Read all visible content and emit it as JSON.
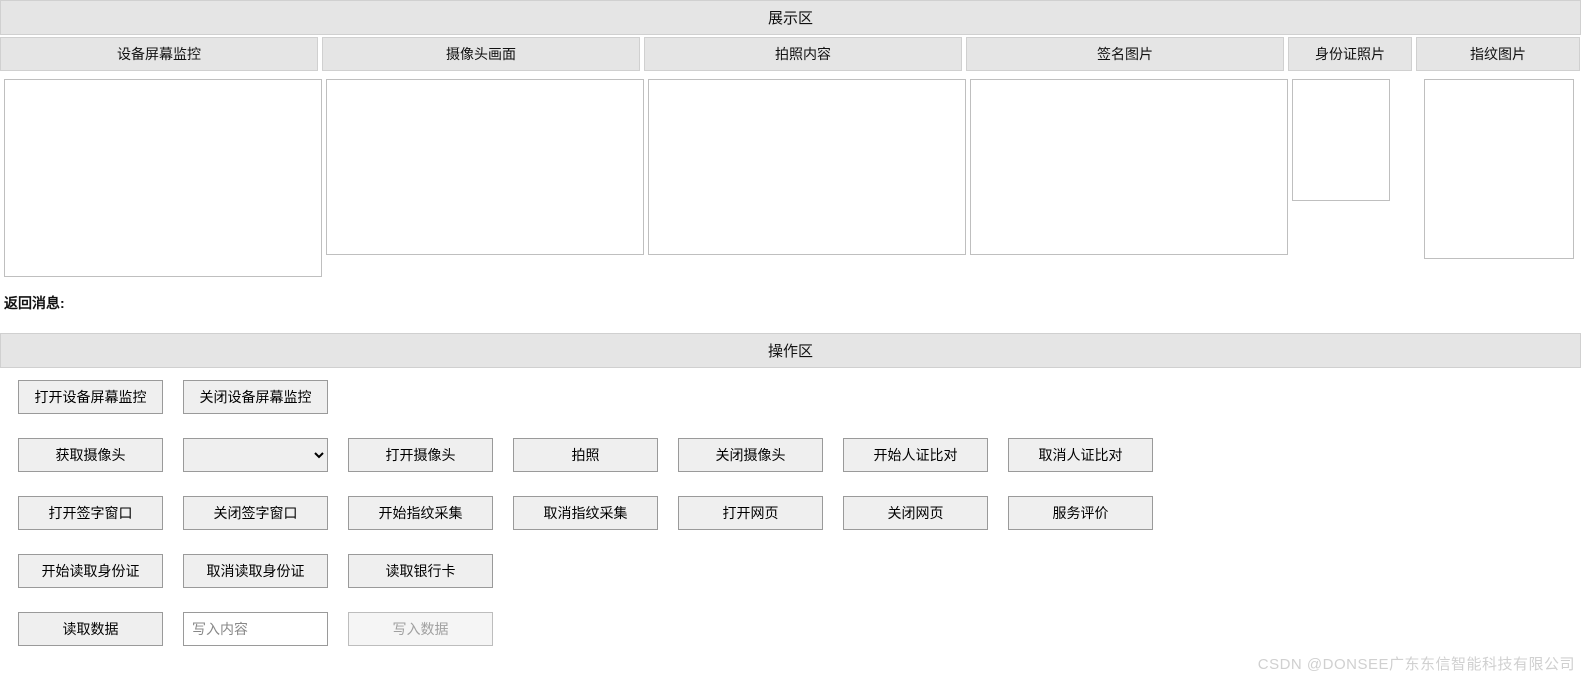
{
  "display_section": {
    "title": "展示区",
    "columns": [
      "设备屏幕监控",
      "摄像头画面",
      "拍照内容",
      "签名图片",
      "身份证照片",
      "指纹图片"
    ]
  },
  "return_message": {
    "label": "返回消息:",
    "value": ""
  },
  "operation_section": {
    "title": "操作区"
  },
  "buttons": {
    "row1": {
      "open_monitor": "打开设备屏幕监控",
      "close_monitor": "关闭设备屏幕监控"
    },
    "row2": {
      "get_camera": "获取摄像头",
      "camera_select": "",
      "open_camera": "打开摄像头",
      "take_photo": "拍照",
      "close_camera": "关闭摄像头",
      "start_face_compare": "开始人证比对",
      "cancel_face_compare": "取消人证比对"
    },
    "row3": {
      "open_sign_window": "打开签字窗口",
      "close_sign_window": "关闭签字窗口",
      "start_fingerprint": "开始指纹采集",
      "cancel_fingerprint": "取消指纹采集",
      "open_webpage": "打开网页",
      "close_webpage": "关闭网页",
      "service_review": "服务评价"
    },
    "row4": {
      "start_read_id": "开始读取身份证",
      "cancel_read_id": "取消读取身份证",
      "read_bank_card": "读取银行卡"
    },
    "row5": {
      "read_data": "读取数据",
      "write_placeholder": "写入内容",
      "write_data": "写入数据"
    }
  },
  "watermark": "CSDN @DONSEE广东东信智能科技有限公司"
}
